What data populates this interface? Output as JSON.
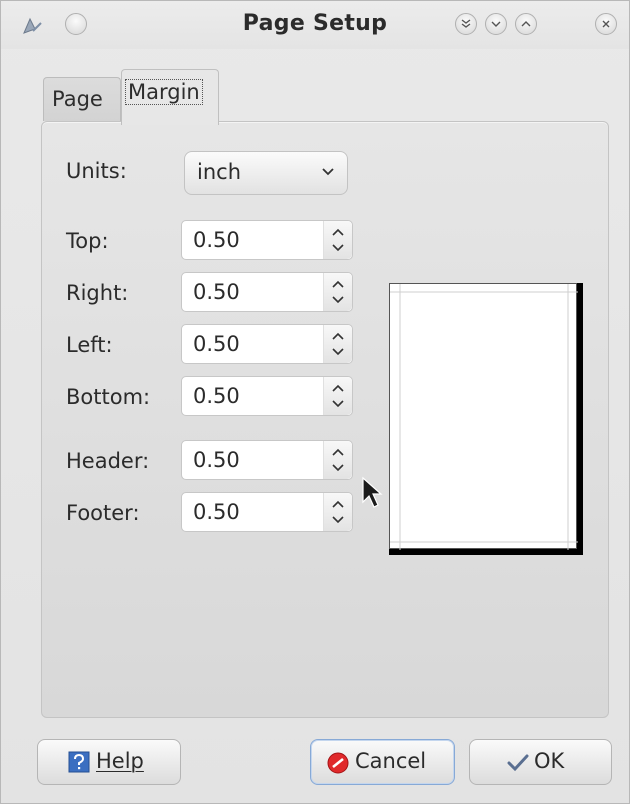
{
  "window": {
    "title": "Page Setup"
  },
  "titlebar_buttons": [
    "minimize-all",
    "minimize",
    "maximize",
    "close"
  ],
  "tabs": [
    {
      "label": "Page",
      "active": false
    },
    {
      "label": "Margin",
      "active": true
    }
  ],
  "units": {
    "label": "Units:",
    "value": "inch"
  },
  "fields": [
    {
      "label": "Top:",
      "value": "0.50"
    },
    {
      "label": "Right:",
      "value": "0.50"
    },
    {
      "label": "Left:",
      "value": "0.50"
    },
    {
      "label": "Bottom:",
      "value": "0.50"
    },
    {
      "label": "Header:",
      "value": "0.50"
    },
    {
      "label": "Footer:",
      "value": "0.50"
    }
  ],
  "buttons": {
    "help": "Help",
    "cancel": "Cancel",
    "ok": "OK"
  },
  "colors": {
    "cancel_icon": "#e0292b",
    "help_icon": "#3b6fc1",
    "ok_check": "#5a6f91"
  }
}
